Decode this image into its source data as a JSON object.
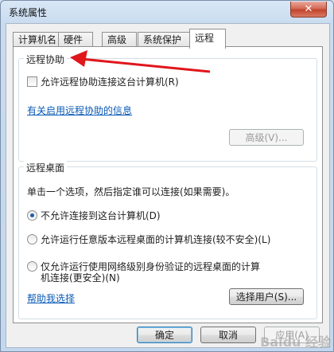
{
  "window": {
    "title": "系统属性",
    "close_glyph": "✕"
  },
  "tabs": [
    {
      "label": "计算机名"
    },
    {
      "label": "硬件"
    },
    {
      "label": "高级"
    },
    {
      "label": "系统保护"
    },
    {
      "label": "远程"
    }
  ],
  "remote_assistance": {
    "group_label": "远程协助",
    "allow_checkbox_label": "允许远程协助连接这台计算机(R)",
    "allow_checked": false,
    "info_link": "有关启用远程协助的信息",
    "advanced_button": "高级(V)..."
  },
  "remote_desktop": {
    "group_label": "远程桌面",
    "instruction": "单击一个选项，然后指定谁可以连接(如果需要)。",
    "options": [
      {
        "label": "不允许连接到这台计算机(D)",
        "checked": true
      },
      {
        "label": "允许运行任意版本远程桌面的计算机连接(较不安全)(L)",
        "checked": false
      },
      {
        "label_line1": "仅允许运行使用网络级别身份验证的远程桌面的计算",
        "label_line2": "机连接(更安全)(N)",
        "checked": false
      }
    ],
    "help_link": "帮助我选择",
    "select_users_button": "选择用户(S)..."
  },
  "footer": {
    "ok_button": "确定",
    "cancel_button": "取消",
    "apply_button": "应用(A)"
  },
  "watermark_text": "Baidu 经验",
  "colors": {
    "arrow": "#e0161b",
    "link": "#0b5bb5"
  }
}
